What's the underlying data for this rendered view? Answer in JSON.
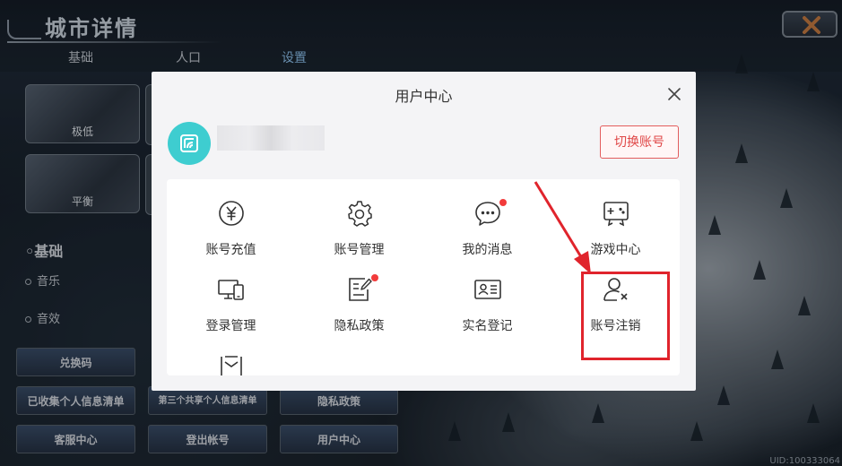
{
  "game": {
    "title": "城市详情",
    "tabs": [
      "基础",
      "人口",
      "设置"
    ],
    "quality_cards": [
      "极低",
      "平衡"
    ],
    "section_title": "基础",
    "options": [
      "音乐",
      "音效"
    ],
    "buttons": {
      "redeem": "兑换码",
      "collected_info": "已收集个人信息清单",
      "third_party_info": "第三个共享个人信息清单",
      "privacy": "隐私政策",
      "customer_service": "客服中心",
      "logout": "登出帐号",
      "user_center": "用户中心"
    },
    "uid": "UID:100333064"
  },
  "modal": {
    "title": "用户中心",
    "switch_account": "切换账号",
    "accent_color": "#e04848",
    "avatar_color": "#3ecdd0",
    "items": [
      {
        "label": "账号充值",
        "icon": "yuan-icon",
        "badge": false
      },
      {
        "label": "账号管理",
        "icon": "gear-icon",
        "badge": false
      },
      {
        "label": "我的消息",
        "icon": "chat-bubble-icon",
        "badge": true
      },
      {
        "label": "游戏中心",
        "icon": "gamepad-icon",
        "badge": false
      },
      {
        "label": "登录管理",
        "icon": "devices-icon",
        "badge": false
      },
      {
        "label": "隐私政策",
        "icon": "document-edit-icon",
        "badge": true
      },
      {
        "label": "实名登记",
        "icon": "id-card-icon",
        "badge": false
      },
      {
        "label": "账号注销",
        "icon": "user-remove-icon",
        "badge": false
      },
      {
        "label": "",
        "icon": "mail-box-icon",
        "badge": false
      }
    ]
  },
  "annotation": {
    "highlight_color": "#e0242c"
  }
}
